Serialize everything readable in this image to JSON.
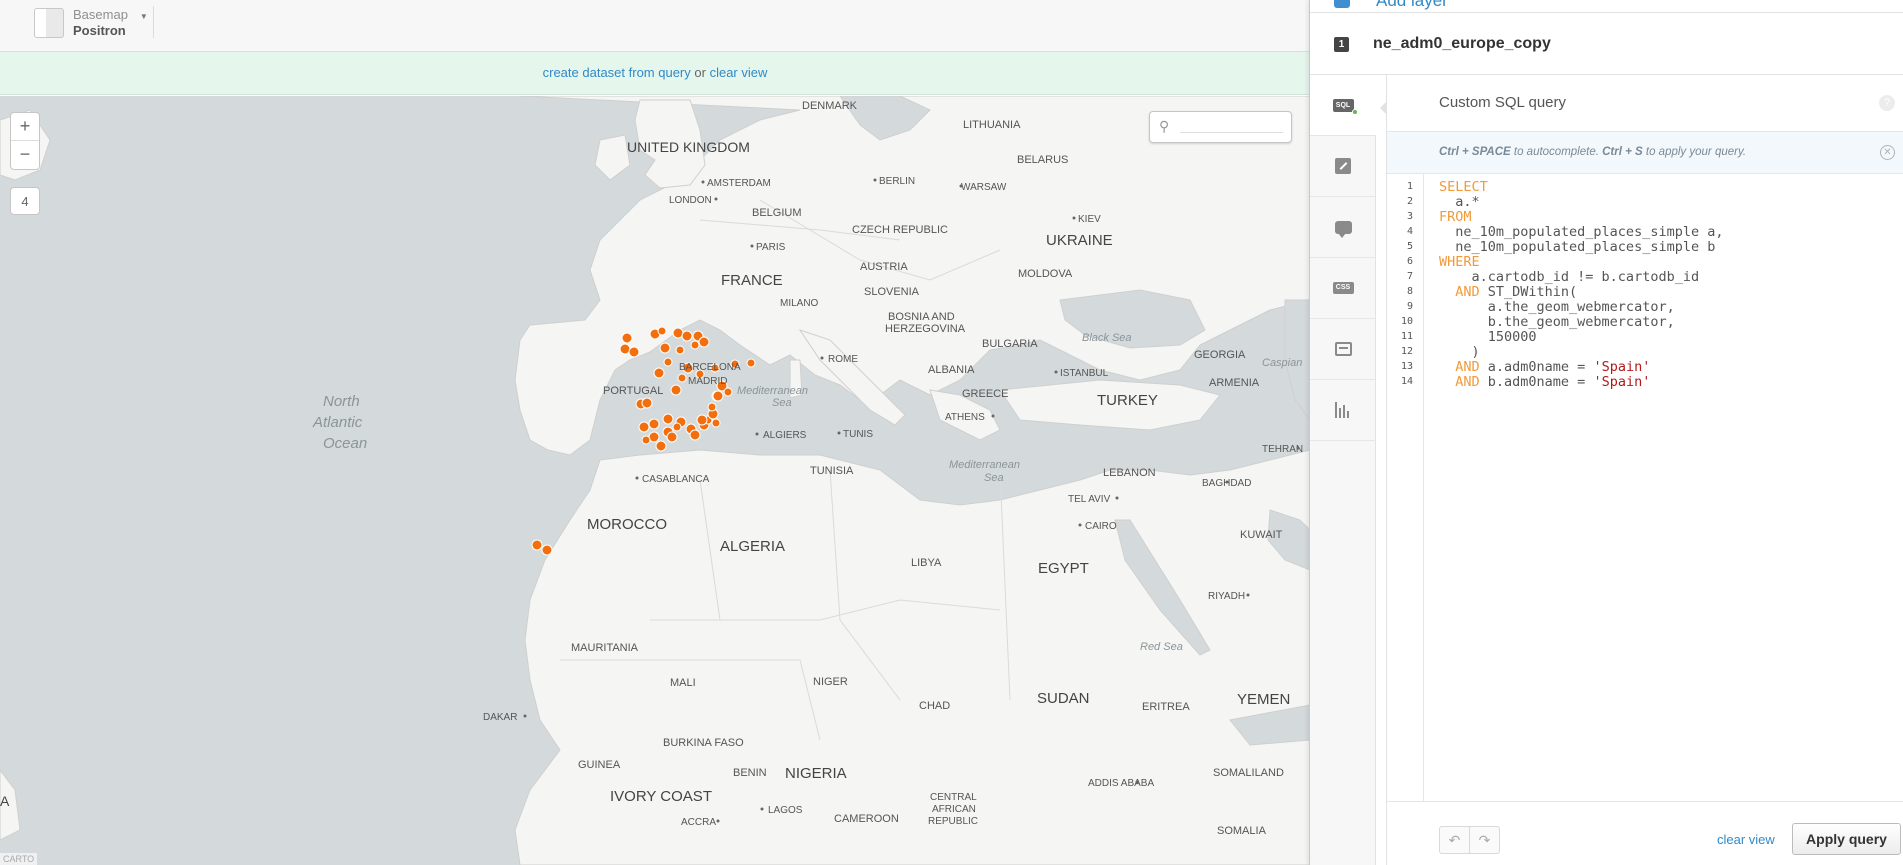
{
  "topbar": {
    "basemap_label": "Basemap",
    "basemap_name": "Positron"
  },
  "notice": {
    "create_link": "create dataset from query",
    "separator": "or",
    "clear_link": "clear view"
  },
  "map": {
    "zoom_in": "+",
    "zoom_out": "−",
    "zoom_level": "4",
    "attribution": "CARTO",
    "colors": {
      "water": "#d4dadc",
      "land": "#f5f5f3",
      "border": "#d0d0d0",
      "points": "#f36f0e"
    },
    "labels": {
      "denmark": "DENMARK",
      "lithuania": "LITHUANIA",
      "uk": "UNITED KINGDOM",
      "belarus": "BELARUS",
      "amsterdam": "AMSTERDAM",
      "london": "LONDON",
      "berlin": "BERLIN",
      "warsaw": "WARSAW",
      "belgium": "BELGIUM",
      "czech": "CZECH REPUBLIC",
      "kiev": "KIEV",
      "paris": "PARIS",
      "ukraine": "UKRAINE",
      "austria": "AUSTRIA",
      "france": "FRANCE",
      "moldova": "MOLDOVA",
      "milano": "MILANO",
      "slovenia": "SLOVENIA",
      "bosnia1": "BOSNIA AND",
      "bosnia2": "HERZEGOVINA",
      "blacksea": "Black Sea",
      "bulgaria": "BULGARIA",
      "georgia": "GEORGIA",
      "caspian": "Caspian",
      "barcelona": "BARCELONA",
      "rome": "ROME",
      "albania": "ALBANIA",
      "istanbul": "ISTANBUL",
      "madrid": "MADRID",
      "portugal": "PORTUGAL",
      "north": "North",
      "atlantic": "Atlantic",
      "ocean": "Ocean",
      "medsea1a": "Mediterranean",
      "medsea1b": "Sea",
      "greece": "GREECE",
      "turkey": "TURKEY",
      "armenia": "ARMENIA",
      "athens": "ATHENS",
      "algiers": "ALGIERS",
      "tunis": "TUNIS",
      "tehran": "TEHRAN",
      "tunisia": "TUNISIA",
      "medsea2a": "Mediterranean",
      "medsea2b": "Sea",
      "casablanca": "CASABLANCA",
      "lebanon": "LEBANON",
      "baghdad": "BAGHDAD",
      "telaviv": "TEL AVIV",
      "cairo": "CAIRO",
      "morocco": "MOROCCO",
      "kuwait": "KUWAIT",
      "algeria": "ALGERIA",
      "libya": "LIBYA",
      "egypt": "EGYPT",
      "riyadh": "RIYADH",
      "redsea": "Red Sea",
      "mauritania": "MAURITANIA",
      "mali": "MALI",
      "niger": "NIGER",
      "sudan": "SUDAN",
      "yemen": "YEMEN",
      "chad": "CHAD",
      "eritrea": "ERITREA",
      "dakar": "DAKAR",
      "burkina": "BURKINA FASO",
      "guinea": "GUINEA",
      "benin": "BENIN",
      "nigeria": "NIGERIA",
      "somaliland": "SOMALILAND",
      "addis": "ADDIS ABABA",
      "ivory": "IVORY COAST",
      "car1": "CENTRAL",
      "car2": "AFRICAN",
      "car3": "REPUBLIC",
      "lagos": "LAGOS",
      "cameroon": "CAMEROON",
      "accra": "ACCRA",
      "somalia": "SOMALIA",
      "edge_a": "A"
    }
  },
  "panel": {
    "add_layer": "Add layer",
    "layer_number": "1",
    "layer_name": "ne_adm0_europe_copy",
    "tabs": [
      "SQL",
      "Wizard",
      "Infowindow",
      "CSS",
      "Legends",
      "Filters"
    ],
    "sql_tab_text": "SQL",
    "css_tab_text": "CSS",
    "editor_title": "Custom SQL query",
    "hint_key1": "Ctrl + SPACE",
    "hint_mid": " to autocomplete. ",
    "hint_key2": "Ctrl + S",
    "hint_end": " to apply your query.",
    "line_numbers": [
      "1",
      "2",
      "3",
      "4",
      "5",
      "6",
      "7",
      "8",
      "9",
      "10",
      "11",
      "12",
      "13",
      "14"
    ],
    "code": {
      "l1": "SELECT",
      "l2": "  a.*",
      "l3": "FROM",
      "l4": "  ne_10m_populated_places_simple a,",
      "l5": "  ne_10m_populated_places_simple b",
      "l6": "WHERE",
      "l7": "    a.cartodb_id != b.cartodb_id",
      "l8_kw": "  AND",
      "l8": " ST_DWithin(",
      "l9": "      a.the_geom_webmercator,",
      "l10": "      b.the_geom_webmercator,",
      "l11": "      150000",
      "l12": "    )",
      "l13_kw": "  AND",
      "l13": " a.adm0name = ",
      "l13_str": "'Spain'",
      "l14_kw": "  AND",
      "l14": " b.adm0name = ",
      "l14_str": "'Spain'"
    },
    "undo": "↶",
    "redo": "↷",
    "clear_view": "clear view",
    "apply_query": "Apply query"
  }
}
